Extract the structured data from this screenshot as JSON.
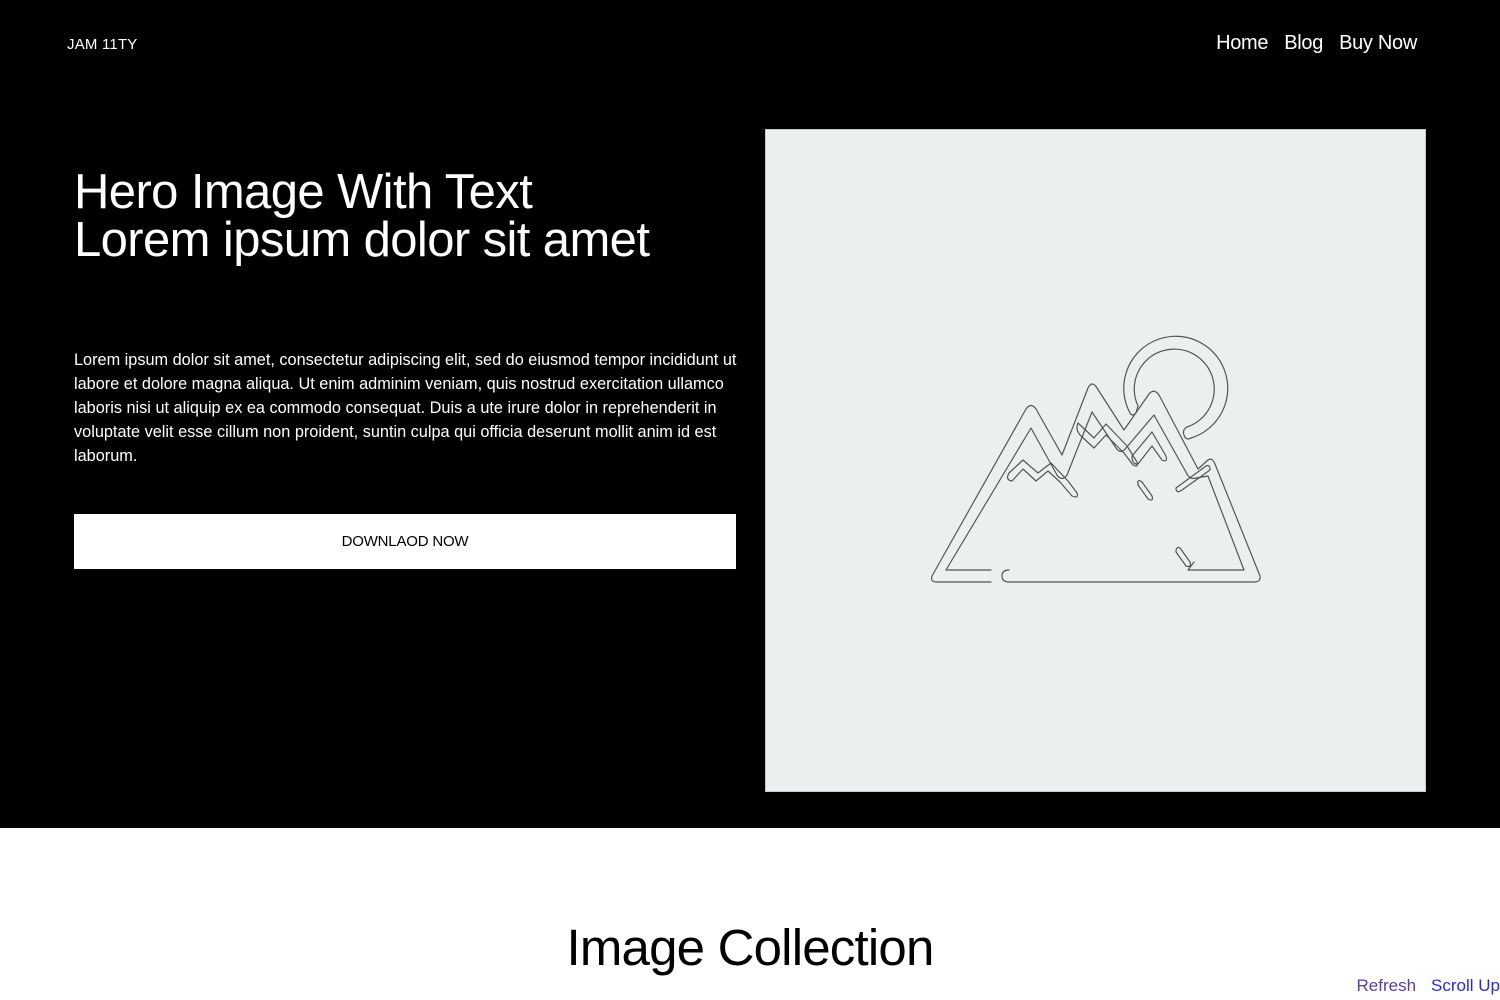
{
  "header": {
    "logo": "JAM 11TY",
    "nav": [
      "Home",
      "Blog",
      "Buy Now"
    ]
  },
  "hero": {
    "title_line1": "Hero Image With Text",
    "title_line2": "Lorem ipsum dolor sit amet",
    "body": "Lorem ipsum dolor sit amet, consectetur adipiscing elit, sed do eiusmod tempor incididunt ut labore et dolore magna aliqua. Ut enim adminim veniam, quis nostrud exercitation ullamco laboris nisi ut aliquip ex ea commodo consequat. Duis a ute irure dolor in reprehenderit in voluptate velit esse cillum non proident, suntin culpa qui officia deserunt mollit anim id est laborum.",
    "cta_label": "DOWNLAOD NOW",
    "image_icon": "mountain-sun-placeholder-icon"
  },
  "section": {
    "title": "Image Collection"
  },
  "utility_links": {
    "refresh": "Refresh",
    "scroll_up": "Scroll Up"
  },
  "colors": {
    "hero_background": "#000000",
    "image_placeholder": "#ebeff0",
    "refresh_link": "#5a3fa0",
    "scroll_up_link": "#2b2bd6"
  }
}
